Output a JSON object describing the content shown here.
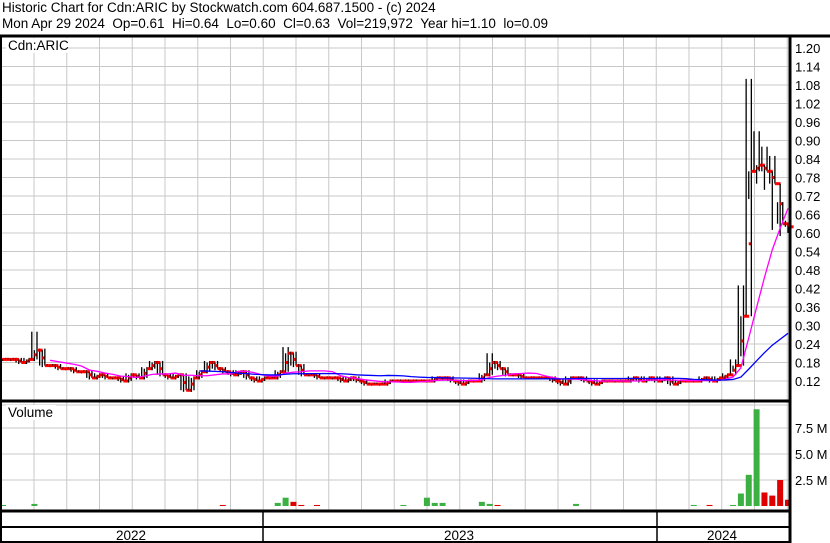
{
  "header": {
    "title": "Historic Chart for Cdn:ARIC by Stockwatch.com 604.687.1500 - (c) 2024",
    "quote": "Mon Apr 29 2024  Op=0.61  Hi=0.64  Lo=0.60  Cl=0.63  Vol=219,972  Year hi=1.10  lo=0.09"
  },
  "chart_data": {
    "type": "line",
    "title": "Cdn:ARIC",
    "price_panel_label": "Cdn:ARIC",
    "volume_panel_label": "Volume",
    "ylim": [
      0.09,
      1.23
    ],
    "y_ticks": [
      "1.20",
      "1.14",
      "1.08",
      "1.02",
      "0.96",
      "0.90",
      "0.84",
      "0.78",
      "0.72",
      "0.66",
      "0.60",
      "0.54",
      "0.48",
      "0.42",
      "0.36",
      "0.30",
      "0.24",
      "0.18",
      "0.12"
    ],
    "volume_ticks": [
      "7.5 M",
      "5.0 M",
      "2.5 M"
    ],
    "volume_ylim_millions": [
      0,
      10
    ],
    "years": [
      "2022",
      "2023",
      "2024"
    ],
    "close": [
      0.19,
      0.19,
      0.18,
      0.19,
      0.22,
      0.17,
      0.17,
      0.16,
      0.16,
      0.15,
      0.15,
      0.13,
      0.14,
      0.13,
      0.13,
      0.12,
      0.14,
      0.13,
      0.16,
      0.18,
      0.14,
      0.13,
      0.14,
      0.09,
      0.13,
      0.15,
      0.18,
      0.16,
      0.15,
      0.14,
      0.15,
      0.13,
      0.12,
      0.13,
      0.13,
      0.15,
      0.21,
      0.17,
      0.14,
      0.14,
      0.13,
      0.13,
      0.13,
      0.12,
      0.13,
      0.12,
      0.11,
      0.11,
      0.11,
      0.12,
      0.12,
      0.12,
      0.12,
      0.12,
      0.12,
      0.13,
      0.13,
      0.12,
      0.11,
      0.12,
      0.12,
      0.14,
      0.18,
      0.16,
      0.14,
      0.14,
      0.13,
      0.13,
      0.13,
      0.13,
      0.12,
      0.11,
      0.13,
      0.13,
      0.12,
      0.11,
      0.12,
      0.12,
      0.12,
      0.12,
      0.13,
      0.12,
      0.13,
      0.12,
      0.13,
      0.11,
      0.12,
      0.12,
      0.12,
      0.13,
      0.12,
      0.13,
      0.14,
      0.17,
      0.33,
      0.8,
      0.82,
      0.8,
      0.76,
      0.63,
      0.62
    ],
    "high_overrides": {
      "4": 0.28,
      "36": 0.23,
      "62": 0.21,
      "93": 0.19,
      "94": 0.43,
      "95": 1.1,
      "96": 0.93,
      "97": 0.88,
      "98": 0.85,
      "99": 0.7,
      "100": 0.64
    },
    "low_overrides": {
      "93": 0.15,
      "94": 0.2,
      "95": 0.71,
      "96": 0.76,
      "97": 0.74,
      "98": 0.61,
      "99": 0.59,
      "100": 0.6
    },
    "volume_millions": [
      0.1,
      0,
      0,
      0,
      0.2,
      0,
      0,
      0,
      0,
      0,
      0,
      0,
      0,
      0,
      0,
      0,
      0,
      0,
      0,
      0,
      0,
      0,
      0,
      0,
      0,
      0,
      0,
      0,
      0.1,
      0,
      0,
      0,
      0,
      0,
      0,
      0.3,
      0.8,
      0.4,
      0.1,
      0,
      0.1,
      0,
      0,
      0,
      0,
      0,
      0,
      0,
      0,
      0,
      0,
      0.1,
      0,
      0,
      0.8,
      0.3,
      0.3,
      0,
      0,
      0,
      0,
      0.4,
      0.2,
      0.1,
      0,
      0,
      0,
      0,
      0,
      0,
      0,
      0,
      0,
      0.2,
      0,
      0,
      0,
      0,
      0,
      0,
      0,
      0,
      0,
      0,
      0,
      0,
      0,
      0,
      0.1,
      0,
      0.1,
      0,
      0,
      0.1,
      1.2,
      3.0,
      9.3,
      1.3,
      1.0,
      2.5,
      0.6
    ],
    "moving_averages": [
      {
        "name": "short MA",
        "color": "#ff00ff",
        "window": 7
      },
      {
        "name": "long MA",
        "color": "#0000ff",
        "window": 26
      }
    ]
  }
}
